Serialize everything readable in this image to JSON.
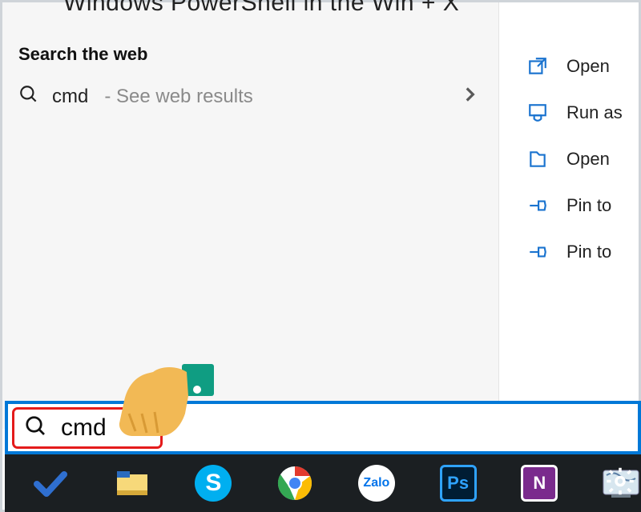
{
  "topCut": "Windows PowerShell in the Win + X",
  "heading": "Search the web",
  "web": {
    "query": "cmd",
    "hint": "- See web results"
  },
  "actions": [
    {
      "icon": "open",
      "label": "Open"
    },
    {
      "icon": "shield",
      "label": "Run as"
    },
    {
      "icon": "folder-o",
      "label": "Open "
    },
    {
      "icon": "pin",
      "label": "Pin to"
    },
    {
      "icon": "pin",
      "label": "Pin to"
    }
  ],
  "search": {
    "value": "cmd"
  },
  "taskbar": [
    {
      "id": "todo",
      "name": "todo-icon"
    },
    {
      "id": "explorer",
      "name": "file-explorer-icon"
    },
    {
      "id": "skype",
      "name": "skype-icon"
    },
    {
      "id": "chrome",
      "name": "chrome-icon"
    },
    {
      "id": "zalo",
      "name": "zalo-icon",
      "text": "Zalo"
    },
    {
      "id": "photoshop",
      "name": "photoshop-icon",
      "text": "Ps"
    },
    {
      "id": "onenote",
      "name": "onenote-icon",
      "text": "N"
    },
    {
      "id": "app",
      "name": "app-icon"
    }
  ]
}
